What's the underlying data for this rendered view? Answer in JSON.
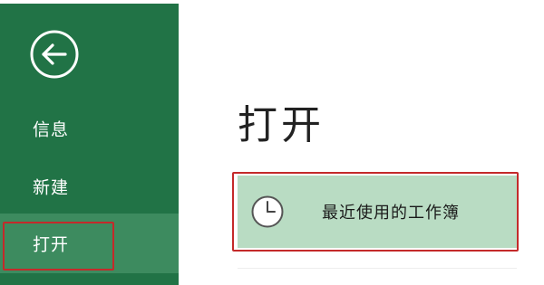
{
  "colors": {
    "sidebar": "#217346",
    "sidebar_selected": "#3d8b5f",
    "recent_highlight": "#b9dcc3",
    "annotation_border": "#c42a2a"
  },
  "sidebar": {
    "back_icon": "back-arrow-icon",
    "items": [
      {
        "label": "信息"
      },
      {
        "label": "新建"
      },
      {
        "label": "打开"
      }
    ]
  },
  "main": {
    "title": "打开",
    "recent": {
      "icon": "clock-icon",
      "label": "最近使用的工作簿"
    }
  }
}
